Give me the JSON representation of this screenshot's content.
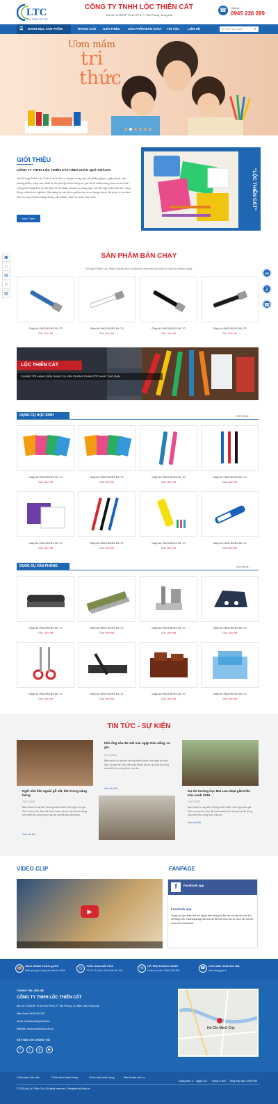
{
  "header": {
    "logo_text": "LTC",
    "logo_tagline": "LỘC THIÊN CÁT JSC",
    "company_name": "CÔNG TY TNHH LỘC THIÊN CÁT",
    "address": "Địa chỉ: 91/53/3P Tổ 46 KP 8, P. Tân Phong, Đồng Nai",
    "hotline_label": "Hotline:",
    "hotline_number": "0945 236 289"
  },
  "nav": {
    "category_label": "DANH MỤC SẢN PHẨM",
    "items": [
      "TRANG CHỦ",
      "GIỚI THIỆU",
      "SẢN PHẨM BÁN CHẠY",
      "TIN TỨC",
      "LIÊN HỆ"
    ],
    "search_placeholder": "Tìm kiếm sản phẩm"
  },
  "hero": {
    "line1": "Ươm mầm",
    "line2": "tri",
    "line3": "thức"
  },
  "intro": {
    "title": "GIỚI THIỆU",
    "subtitle": "CÔNG TY TNHH LỘC THIÊN CÁT KÍNH CHÀO QUÝ KHÁCH!",
    "body": "Văn Phòng Phẩm Lộc Thiên Cát là đơn vị chuyên cung cấp sản phẩm giấy in, giấy photo, văn phòng phẩm, máy móc, thiết bị văn phòng chính hãng với giá cả và chất lượng phục vụ tốt nhất, chúng tôi mong đem sự ổn định về số phẩm và dịch vụ cung cấp. Với đội ngũ nhân viên trẻ, năng động, nhiều kinh nghiệm. Sẵn sàng tư vấn kinh nghiệm lựa chọn hàng nhanh, đề phục vụ và đem đến cho Quý khách hàng những sản phẩm - dịch vụ hoàn hảo nhất.",
    "button": "Xem Thêm",
    "image_caption": "\"LỘC THIÊN CÁT\""
  },
  "bestsellers": {
    "title": "SẢN PHẨM BÁN CHẠY",
    "desc": "Đội ngũ CBNV Lộc Thiên Cát sẽ phục vụ tận tình theo yêu cầu hợp lý của Quý khách hàng.",
    "products": [
      {
        "name": "Giấy A4 PAGI BOSS ĐL 70",
        "price_label": "Giá:",
        "price": "Liên hệ"
      },
      {
        "name": "Giấy A4 PAGI BOSS ĐL 70",
        "price_label": "Giá:",
        "price": "Liên hệ"
      },
      {
        "name": "Giấy A4 PAGI BOSS ĐL 70",
        "price_label": "Giá:",
        "price": "Liên hệ"
      },
      {
        "name": "Giấy A4 PAGI BOSS ĐL 70",
        "price_label": "Giá:",
        "price": "Liên hệ"
      }
    ]
  },
  "banner": {
    "title": "LỘC THIÊN CÁT",
    "subtitle": "CHÚNG TÔI MANG ĐẾN DỤNG CỤ VĂN PHÒNG PHẨM TỐT NHẤT CHO BẠN"
  },
  "school": {
    "title": "DỤNG CỤ HỌC SINH",
    "see_all": "Xem tất cả »",
    "products": [
      {
        "name": "Giấy A4 PAGI BOSS ĐL 70",
        "price_label": "Giá:",
        "price": "Liên hệ"
      },
      {
        "name": "Giấy A4 PAGI BOSS ĐL 70",
        "price_label": "Giá:",
        "price": "Liên hệ"
      },
      {
        "name": "Giấy A4 PAGI BOSS ĐL 70",
        "price_label": "Giá:",
        "price": "Liên hệ"
      },
      {
        "name": "Giấy A4 PAGI BOSS ĐL 70",
        "price_label": "Giá:",
        "price": "Liên hệ"
      },
      {
        "name": "Giấy A4 PAGI BOSS ĐL 70",
        "price_label": "Giá:",
        "price": "Liên hệ"
      },
      {
        "name": "Giấy A4 PAGI BOSS ĐL 70",
        "price_label": "Giá:",
        "price": "Liên hệ"
      },
      {
        "name": "Giấy A4 PAGI BOSS ĐL 70",
        "price_label": "Giá:",
        "price": "Liên hệ"
      },
      {
        "name": "Giấy A4 PAGI BOSS ĐL 70",
        "price_label": "Giá:",
        "price": "Liên hệ"
      }
    ]
  },
  "office": {
    "title": "DỤNG CỤ VĂN PHÒNG",
    "see_all": "Xem tất cả »",
    "products": [
      {
        "name": "Giấy A4 PAGI BOSS ĐL 70",
        "price_label": "Giá:",
        "price": "Liên hệ"
      },
      {
        "name": "Giấy A4 PAGI BOSS ĐL 70",
        "price_label": "Giá:",
        "price": "Liên hệ"
      },
      {
        "name": "Giấy A4 PAGI BOSS ĐL 70",
        "price_label": "Giá:",
        "price": "Liên hệ"
      },
      {
        "name": "Giấy A4 PAGI BOSS ĐL 70",
        "price_label": "Giá:",
        "price": "Liên hệ"
      },
      {
        "name": "Giấy A4 PAGI BOSS ĐL 70",
        "price_label": "Giá:",
        "price": "Liên hệ"
      },
      {
        "name": "Giấy A4 PAGI BOSS ĐL 70",
        "price_label": "Giá:",
        "price": "Liên hệ"
      },
      {
        "name": "Giấy A4 PAGI BOSS ĐL 70",
        "price_label": "Giá:",
        "price": "Liên hệ"
      },
      {
        "name": "Giấy A4 PAGI BOSS ĐL 70",
        "price_label": "Giá:",
        "price": "Liên hệ"
      }
    ]
  },
  "news": {
    "title": "TIN TỨC - SỰ KIỆN",
    "items": [
      {
        "title": "Ngôi nhà liên ngoài gỗ sắt, bên trong sáng bừng",
        "date": "14.07.2020",
        "body": "Bạn muốn tự tay làm những chiếc bánh xinh ngọt cho gia đình và bạn bè. Bạn đã hoàn thành tất cả các loại đồ dùng cần thiết cho công thức nấu ăn và bắt đầu làm bánh.",
        "more": "Xem chi tiết"
      },
      {
        "title": "Nhà ống sâu 35 mét sản ngập tràn nắng, và gió",
        "date": "14.07.2020",
        "body": "Bạn muốn tự tay làm những chiếc bánh xinh ngọt cho gia đình và bạn bè. Bạn đã hoàn thành tất cả các loại đồ dùng cần thiết cho công thức nấu ăn.",
        "more": "Xem chi tiết"
      },
      {
        "title": "Dự án trường học Mai Lưu đoạt giải Kiến trúc xanh 2019",
        "date": "14.07.2020",
        "body": "Bạn muốn tự tay làm những chiếc bánh xinh ngọt cho gia đình và bạn bè. Bạn đã hoàn thành tất cả các loại đồ dùng cần thiết cho công thức nấu ăn.",
        "more": "Xem chi tiết"
      }
    ]
  },
  "video": {
    "title": "VIDEO CLIP"
  },
  "fanpage": {
    "title": "FANPAGE",
    "page_name": "Facebook app",
    "post_text": "Trong số các nhiều kết nối ngoài đến thông tin liên lạc và bạn chỉ cần tìm và trang chủ. Facebook app đã chia sẻ liên kết hữu ích về cách kết nối với nhau trên Facebook."
  },
  "footer_strip": [
    {
      "title": "GIAO HÀNG TOÀN QUỐC",
      "sub": "Miễn phí giao hàng các đơn từ 500k",
      "icon": "truck-icon"
    },
    {
      "title": "THỜI GIAN MỞ CỬA",
      "sub": "T2-T6: 8h-18h, Chủ nhật: 8h-15h",
      "icon": "clock-icon"
    },
    {
      "title": "HỖ TRỢ KHÁCH HÀNG",
      "sub": "Hotline tư vấn: 0945 236 289",
      "icon": "headset-icon"
    },
    {
      "title": "HOTLINE: 0945 236 289",
      "sub": "Mua hàng giá rẻ",
      "icon": "phone-icon"
    }
  ],
  "footer": {
    "contact_heading": "THÔNG TIN LIÊN HỆ",
    "company": "CÔNG TY TNHH LỘC THIÊN CÁT",
    "address": "Địa chỉ: 91/53/3P Tổ 46 Khu Phố 8, P. Tân Phong, Tp. Biên Hòa, Đồng Nai",
    "phone": "Điện thoại: 0945 236 289",
    "email": "Email: locthiencat@gmail.com",
    "website": "Website: www.locthiencat.com.vn",
    "social_heading": "KẾT NỐI VỚI CHÚNG TÔI",
    "map_label": "Hồ Chí Minh City"
  },
  "bottom": {
    "links": [
      "Chính sách bảo mật",
      "Chính sách khách hàng",
      "Chính sách chất lượng",
      "Điều khoản dịch vụ"
    ],
    "copyright": "© 2020 by Lộc Thiên Cát. All rights reserved. Designed by Nina.vn",
    "stats": [
      "Đang xem: 5",
      "Ngày: 617",
      "Tháng: 5,991",
      "Tổng truy cập: 9,999,999"
    ]
  },
  "colors": {
    "brand_blue": "#1f66b3",
    "brand_red": "#d7262b"
  }
}
